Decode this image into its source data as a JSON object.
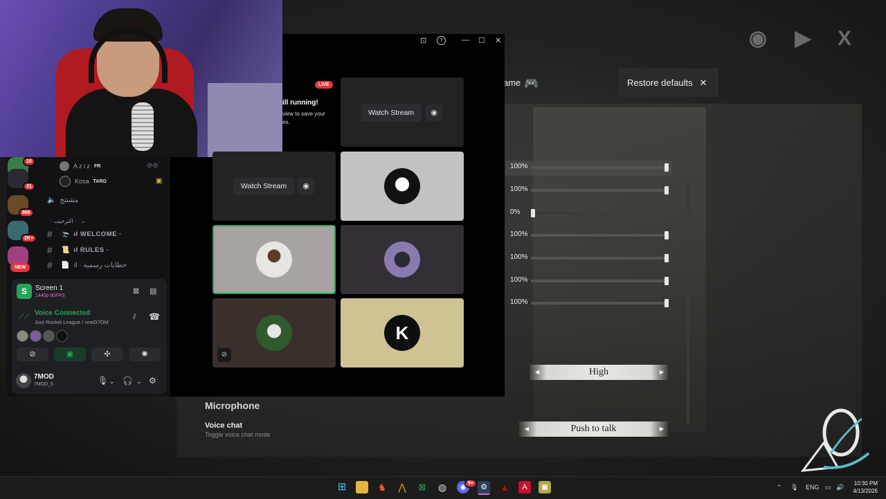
{
  "game": {
    "header_title": "ame",
    "restore_label": "Restore defaults",
    "slider_values": [
      "100%",
      "100%",
      "0%",
      "100%",
      "100%",
      "100%",
      "100%"
    ],
    "slider_levels": [
      1,
      1,
      0,
      1,
      1,
      1,
      1
    ],
    "quality_value": "High",
    "microphone_heading": "Microphone",
    "voice_chat_title": "Voice chat",
    "voice_chat_desc": "Toggle voice chat mode",
    "voice_chat_value": "Push to talk"
  },
  "discord": {
    "server_badges": [
      "10",
      "31",
      "906",
      "2K+"
    ],
    "new_badge": "NEW",
    "voice_users": [
      {
        "name": "A z i z",
        "tag": "FR"
      },
      {
        "name": "Kosa",
        "tag": "TARG"
      }
    ],
    "voice_channel": "مشتتج",
    "category": "· الترحيب ·",
    "channels": [
      "ıl WELCOME ·",
      "ıl RULES ·",
      "ıl · خطابات رسمية"
    ],
    "screen_title": "Screen 1",
    "screen_sub": "1440p 60FPS",
    "voice_connected": "Voice Connected",
    "voice_sub": "Just Rocket League / oneD7OM",
    "username": "7MOD",
    "user_tag": "7MOD_6"
  },
  "call": {
    "live": "LIVE",
    "still_running": "ill running!",
    "still_sub": "view to save your\nes.",
    "watch_label": "Watch Stream"
  },
  "taskbar": {
    "lang": "ENG",
    "time": "10:30 PM",
    "date": "4/13/2026",
    "discord_badge": "9+"
  },
  "colors": {
    "discord_green": "#23a55a",
    "badge_red": "#e2363c",
    "stream_purple": "#e06ad6"
  }
}
